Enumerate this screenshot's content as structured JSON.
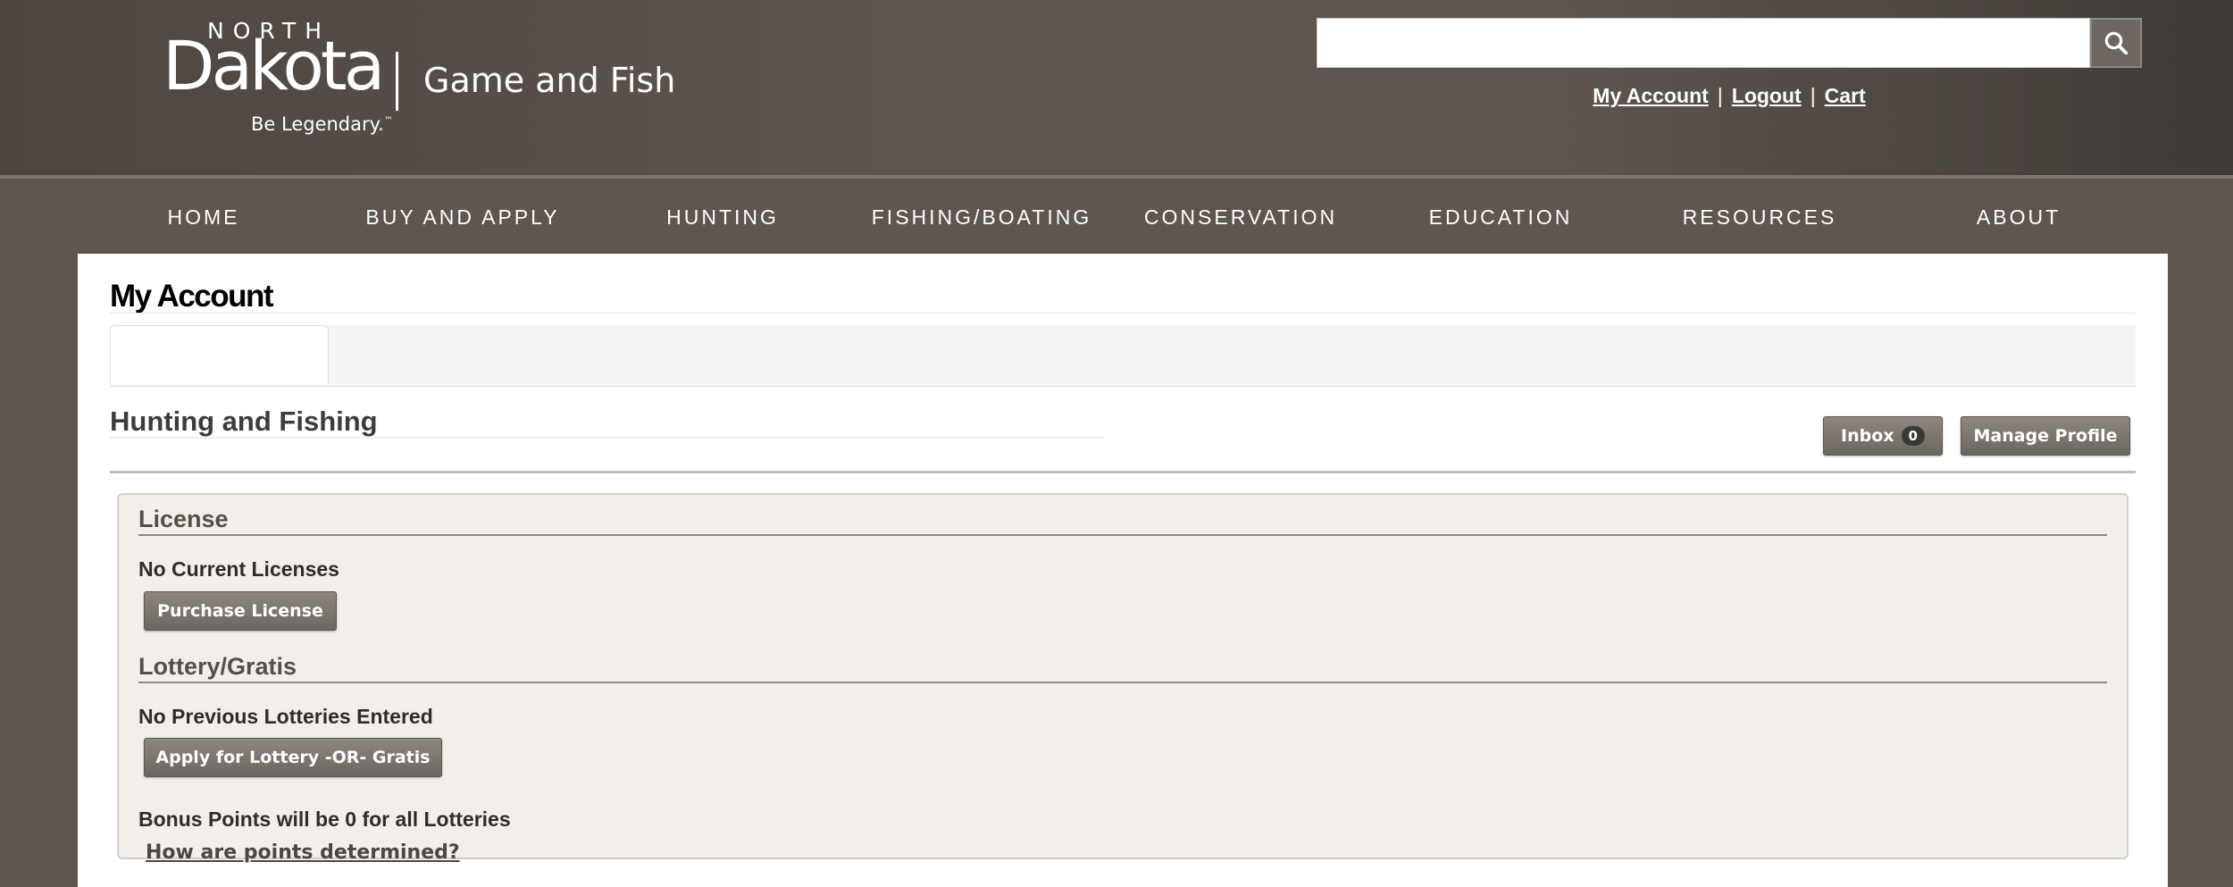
{
  "header": {
    "logo": {
      "north": "NORTH",
      "dakota": "Dakota",
      "tagline": "Be Legendary.",
      "tm": "™",
      "agency": "Game and Fish"
    },
    "search": {
      "placeholder": "",
      "value": "",
      "icon": "search-icon"
    },
    "links": {
      "my_account": "My Account",
      "logout": "Logout",
      "cart": "Cart",
      "separator": "|"
    }
  },
  "nav": {
    "items": [
      "HOME",
      "BUY AND APPLY",
      "HUNTING",
      "FISHING/BOATING",
      "CONSERVATION",
      "EDUCATION",
      "RESOURCES",
      "ABOUT"
    ]
  },
  "main": {
    "page_title": "My Account",
    "section_title": "Hunting and Fishing",
    "inbox_label": "Inbox",
    "inbox_count": "0",
    "manage_profile_label": "Manage Profile",
    "license": {
      "heading": "License",
      "status": "No Current Licenses",
      "button": "Purchase License"
    },
    "lottery": {
      "heading": "Lottery/Gratis",
      "status": "No Previous Lotteries Entered",
      "button": "Apply for Lottery -OR- Gratis",
      "bonus_text": "Bonus Points will be 0 for all Lotteries",
      "points_link": "How are points determined?"
    }
  },
  "colors": {
    "header_bg": "#5e554f",
    "page_bg": "#5f5650",
    "panel_bg": "#f2eeea",
    "button_bg": "#7a756e"
  }
}
